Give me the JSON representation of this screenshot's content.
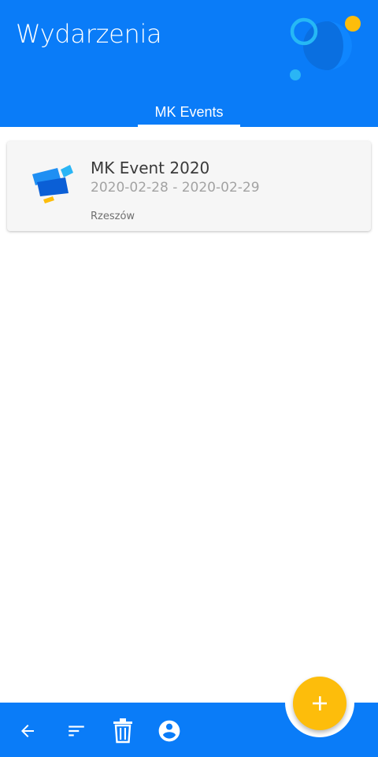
{
  "header": {
    "title": "Wydarzenia",
    "logo_icon": "decorative-circles-logo",
    "background_color": "#0a7cf8"
  },
  "tabs": [
    {
      "label": "MK Events",
      "selected": true
    }
  ],
  "events": [
    {
      "title": "MK Event 2020",
      "dates": "2020-02-28 - 2020-02-29",
      "city": "Rzeszów",
      "thumbnail_icon": "event-logo-icon"
    }
  ],
  "bottom_bar": {
    "icons": [
      "back-arrow-icon",
      "sort-icon",
      "trash-icon",
      "account-circle-icon"
    ]
  },
  "fab": {
    "icon": "plus-icon",
    "color": "#fdbd0b"
  }
}
